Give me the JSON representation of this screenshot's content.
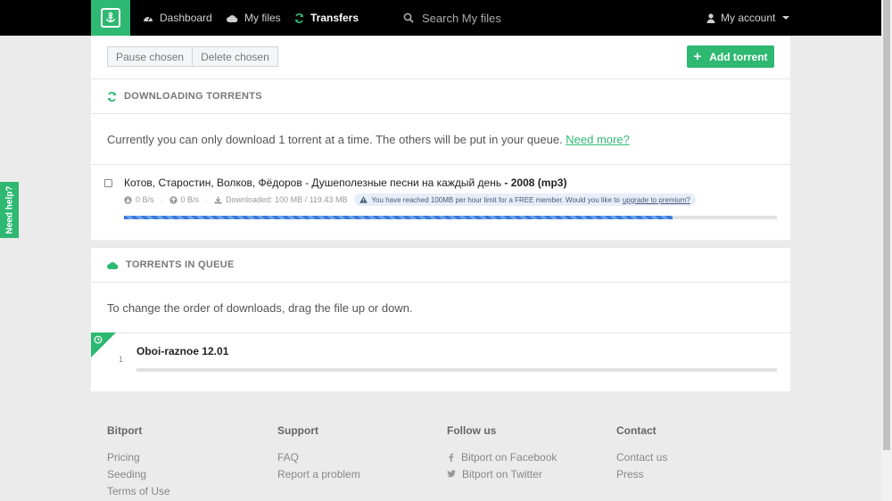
{
  "nav": {
    "items": [
      {
        "label": "Dashboard",
        "icon": "dashboard-icon"
      },
      {
        "label": "My files",
        "icon": "cloud-icon"
      },
      {
        "label": "Transfers",
        "icon": "refresh-icon",
        "active": true
      }
    ],
    "search_placeholder": "Search My files",
    "account_label": "My account"
  },
  "help_tab": "Need help?",
  "toolbar": {
    "pause_label": "Pause chosen",
    "delete_label": "Delete chosen",
    "add_label": "Add torrent"
  },
  "downloading": {
    "title": "DOWNLOADING TORRENTS",
    "notice": "Currently you can only download 1 torrent at a time. The others will be put in your queue.",
    "notice_link": "Need more?",
    "torrent": {
      "name_main": "Котов, Старостин, Волков, Фёдоров - Душеполезные песни на каждый день",
      "name_suffix": " - 2008 (mp3)",
      "down_speed": "0 B/s",
      "up_speed": "0 B/s",
      "downloaded": "Downloaded: 100 MB / 119.43 MB",
      "warning": "You have reached 100MB per hour limit for a FREE member. Would you like to",
      "warning_link": "upgrade to premium?",
      "progress": 0.84
    }
  },
  "queue": {
    "title": "TORRENTS IN QUEUE",
    "notice": "To change the order of downloads, drag the file up or down.",
    "items": [
      {
        "position": "1",
        "name": "Oboi-raznoe 12.01"
      }
    ]
  },
  "footer": {
    "columns": [
      {
        "heading": "Bitport",
        "links": [
          "Pricing",
          "Seeding",
          "Terms of Use"
        ]
      },
      {
        "heading": "Support",
        "links": [
          "FAQ",
          "Report a problem"
        ]
      },
      {
        "heading": "Follow us",
        "links": [
          "Bitport on Facebook",
          "Bitport on Twitter"
        ]
      },
      {
        "heading": "Contact",
        "links": [
          "Contact us",
          "Press"
        ]
      }
    ]
  },
  "colors": {
    "brand": "#2eb872",
    "nav_bg": "#000000",
    "progress": "#3a78d8"
  }
}
